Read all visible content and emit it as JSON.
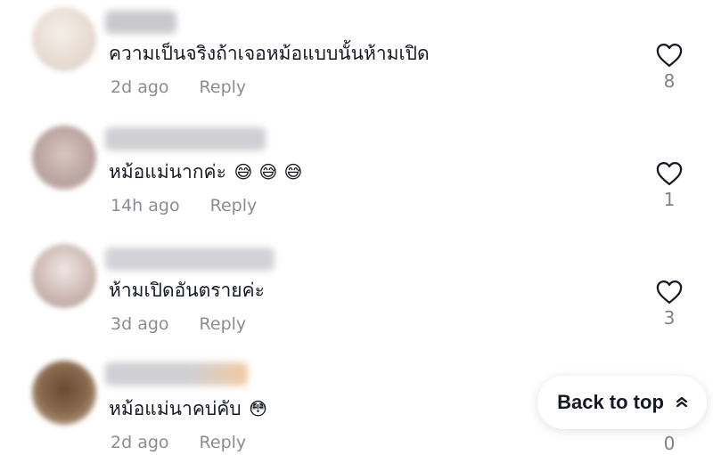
{
  "comments": [
    {
      "text": "ความเป็นจริงถ้าเจอหม้อแบบนั้นห้ามเปิด",
      "emojis": [],
      "time": "2d ago",
      "reply_label": "Reply",
      "likes": "8"
    },
    {
      "text": "หม้อแม่นากค่ะ",
      "emojis": [
        "😅",
        "😅",
        "😅"
      ],
      "time": "14h ago",
      "reply_label": "Reply",
      "likes": "1"
    },
    {
      "text": "ห้ามเปิดอันตรายค่ะ",
      "emojis": [],
      "time": "3d ago",
      "reply_label": "Reply",
      "likes": "3"
    },
    {
      "text": "หม้อแม่นาคบ่คับ",
      "emojis": [
        "😳"
      ],
      "time": "2d ago",
      "reply_label": "Reply",
      "likes": "0"
    }
  ],
  "back_to_top": {
    "label": "Back to top",
    "icon": "chevron-up-double-icon"
  },
  "colors": {
    "text": "#161823",
    "muted": "#8a8b91",
    "heart_outline": "#161823"
  }
}
